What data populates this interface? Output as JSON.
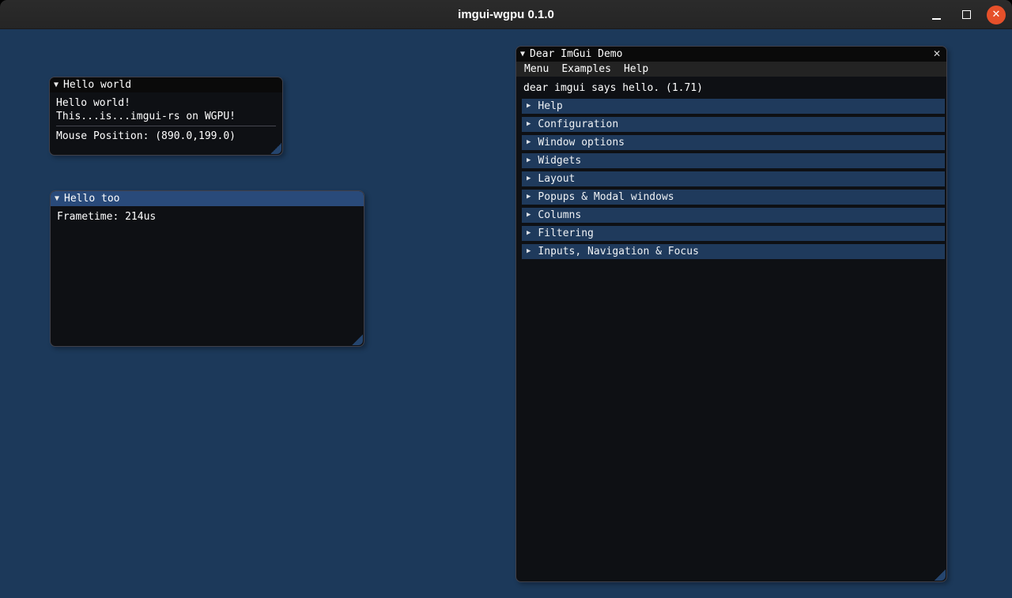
{
  "titlebar": {
    "title": "imgui-wgpu 0.1.0"
  },
  "icons": {
    "expanded_arrow": "▼",
    "collapsed_arrow": "▶",
    "close_x": "✕"
  },
  "colors": {
    "desktop_background": "#1c395a",
    "active_title_blue": "#294a7a",
    "collapsing_header_blue": "#1f3a5c",
    "os_close_button_orange": "#e6502a",
    "window_background": "#0e1014"
  },
  "hello_world_window": {
    "title": "Hello world",
    "line1": "Hello world!",
    "line2": "This...is...imgui-rs on WGPU!",
    "mouse_position": "Mouse Position: (890.0,199.0)"
  },
  "hello_too_window": {
    "title": "Hello too",
    "frametime": "Frametime: 214us"
  },
  "demo_window": {
    "title": "Dear ImGui Demo",
    "menu": [
      "Menu",
      "Examples",
      "Help"
    ],
    "greeting": "dear imgui says hello. (1.71)",
    "headers": [
      "Help",
      "Configuration",
      "Window options",
      "Widgets",
      "Layout",
      "Popups & Modal windows",
      "Columns",
      "Filtering",
      "Inputs, Navigation & Focus"
    ]
  }
}
